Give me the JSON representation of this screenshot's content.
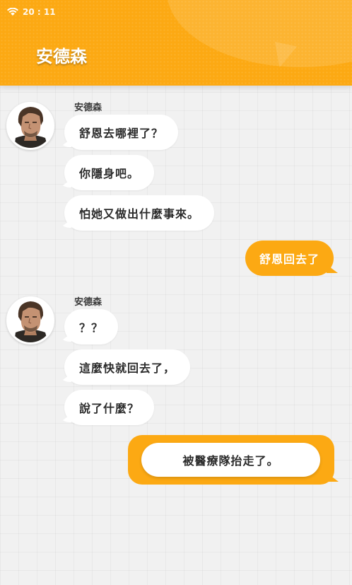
{
  "status_bar": {
    "time": "20 : 11"
  },
  "header": {
    "title": "安德森"
  },
  "contact": {
    "name": "安德森"
  },
  "messages": [
    {
      "from": "contact",
      "text": "舒恩去哪裡了？"
    },
    {
      "from": "contact",
      "text": "你隱身吧。"
    },
    {
      "from": "contact",
      "text": "怕她又做出什麼事來。"
    },
    {
      "from": "me",
      "text": "舒恩回去了"
    },
    {
      "from": "contact",
      "text": "？？"
    },
    {
      "from": "contact",
      "text": "這麼快就回去了，"
    },
    {
      "from": "contact",
      "text": "說了什麼？"
    }
  ],
  "reply_choice": {
    "text": "被醫療隊抬走了。"
  },
  "colors": {
    "accent": "#fca913",
    "bubble_left": "#ffffff",
    "background": "#f1f1f1"
  }
}
